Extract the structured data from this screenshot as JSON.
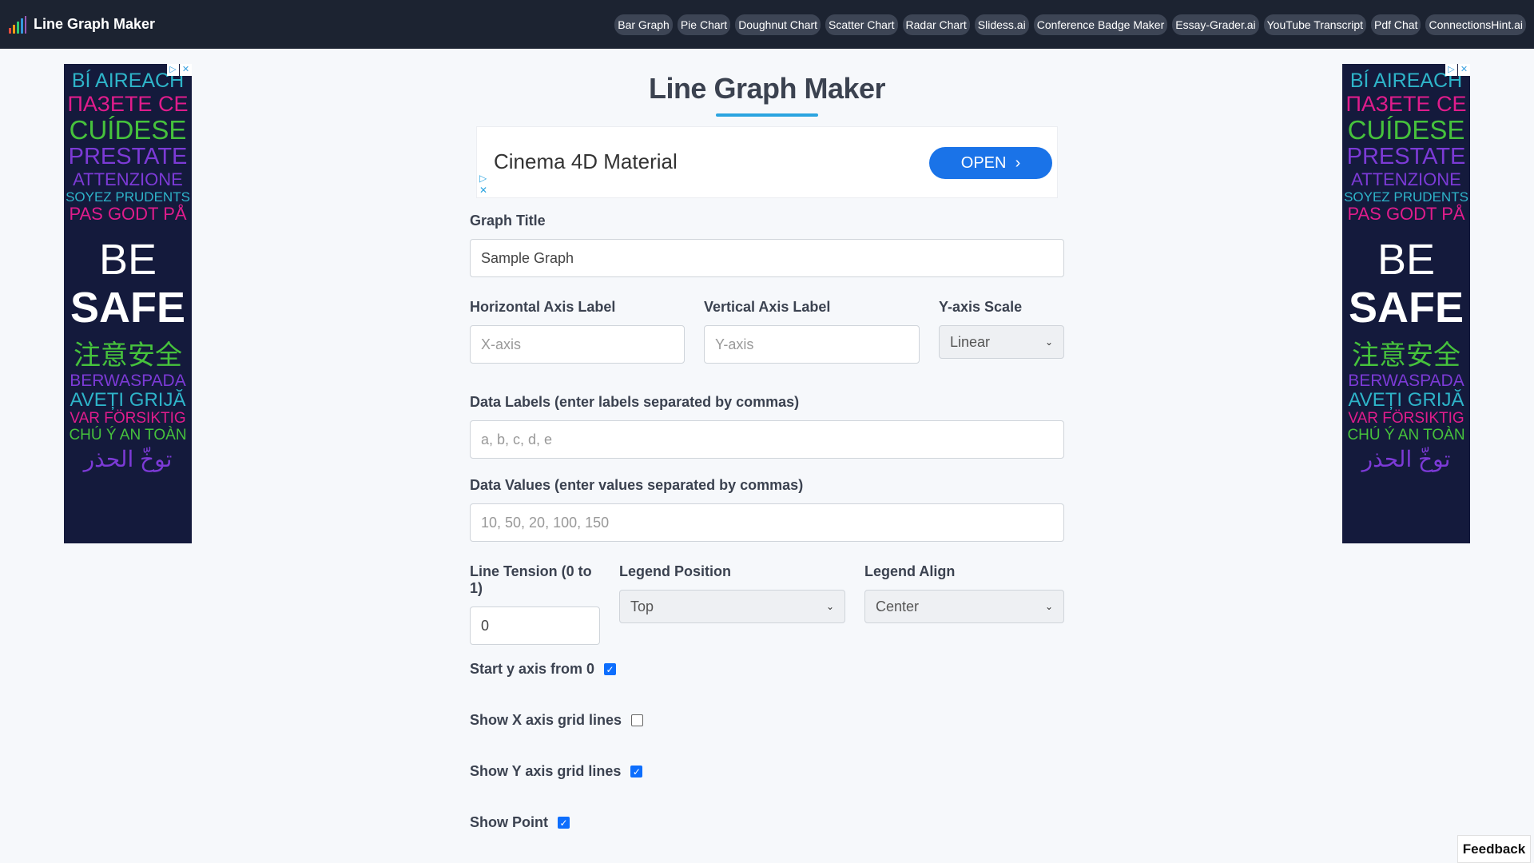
{
  "nav": {
    "brand": "Line Graph Maker",
    "links": [
      "Bar Graph",
      "Pie Chart",
      "Doughnut Chart",
      "Scatter Chart",
      "Radar Chart",
      "Slidess.ai",
      "Conference Badge Maker",
      "Essay-Grader.ai",
      "YouTube Transcript",
      "Pdf Chat",
      "ConnectionsHint.ai"
    ]
  },
  "side_ad": {
    "lines": [
      {
        "text": "BÍ AIREACH",
        "color": "#2eb4c9"
      },
      {
        "text": "ПАЗЕТЕ СЕ",
        "color": "#e01c8c"
      },
      {
        "text": "CUÍDESE",
        "color": "#46c23c"
      },
      {
        "text": "PRESTATE",
        "color": "#7c3ad6"
      },
      {
        "text": "ATTENZIONE",
        "color": "#7c3ad6"
      },
      {
        "text": "SOYEZ PRUDENTS",
        "color": "#2eb4c9"
      },
      {
        "text": "PAS GODT PÅ",
        "color": "#e01c8c"
      },
      {
        "text": "BE",
        "color": "#ffffff"
      },
      {
        "text": "SAFE",
        "color": "#ffffff"
      },
      {
        "text": "注意安全",
        "color": "#46c23c"
      },
      {
        "text": "BERWASPADA",
        "color": "#7c3ad6"
      },
      {
        "text": "AVEȚI GRIJĂ",
        "color": "#2eb4c9"
      },
      {
        "text": "VAR FÖRSIKTIG",
        "color": "#e01c8c"
      },
      {
        "text": "CHÚ Ý AN TOÀN",
        "color": "#46c23c"
      },
      {
        "text": "توخّ الحذر",
        "color": "#7c3ad6"
      }
    ]
  },
  "main": {
    "title": "Line Graph Maker",
    "banner_ad": {
      "text": "Cinema 4D Material",
      "button": "OPEN"
    },
    "graph_title": {
      "label": "Graph Title",
      "value": "Sample Graph"
    },
    "x_label": {
      "label": "Horizontal Axis Label",
      "placeholder": "X-axis"
    },
    "y_label": {
      "label": "Vertical Axis Label",
      "placeholder": "Y-axis"
    },
    "y_scale": {
      "label": "Y-axis Scale",
      "value": "Linear"
    },
    "data_labels": {
      "label": "Data Labels (enter labels separated by commas)",
      "placeholder": "a, b, c, d, e"
    },
    "data_values": {
      "label": "Data Values (enter values separated by commas)",
      "placeholder": "10, 50, 20, 100, 150"
    },
    "tension": {
      "label": "Line Tension (0 to 1)",
      "value": "0"
    },
    "legend_position": {
      "label": "Legend Position",
      "value": "Top"
    },
    "legend_align": {
      "label": "Legend Align",
      "value": "Center"
    },
    "checkboxes": [
      {
        "label": "Start y axis from 0",
        "checked": true
      },
      {
        "label": "Show X axis grid lines",
        "checked": false
      },
      {
        "label": "Show Y axis grid lines",
        "checked": true
      },
      {
        "label": "Show Point",
        "checked": true
      }
    ]
  },
  "feedback": "Feedback"
}
